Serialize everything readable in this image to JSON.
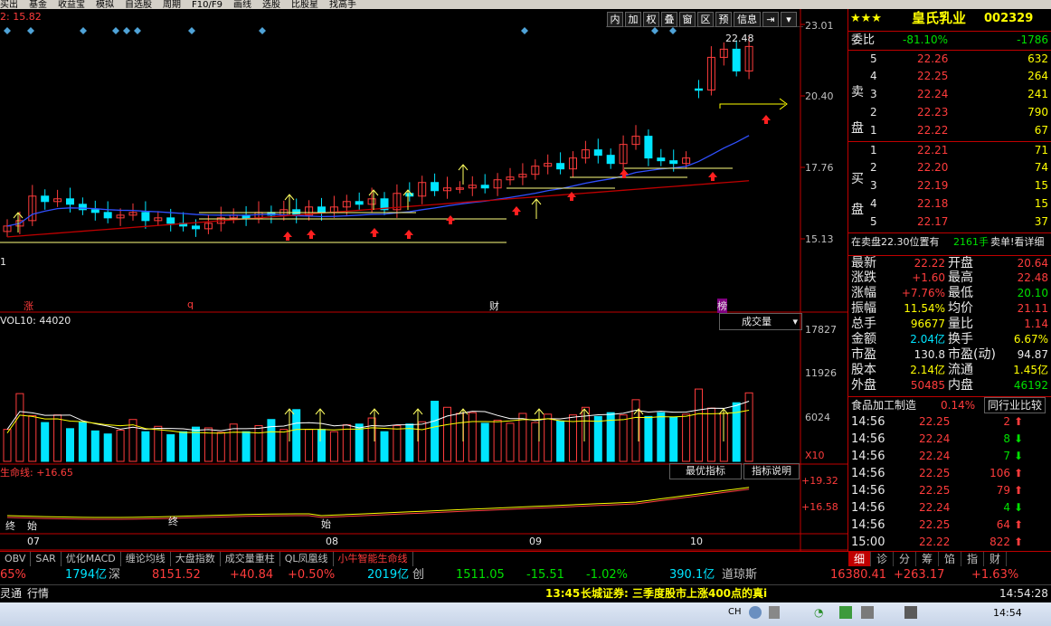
{
  "menu": [
    "买出",
    "基金",
    "收益宝",
    "模拟",
    "自选股",
    "周期",
    "F10/F9",
    "画线",
    "选股",
    "比股星",
    "找高手"
  ],
  "toolbar": [
    "内",
    "加",
    "权",
    "叠",
    "窗",
    "区",
    "预",
    "信息",
    "⇥",
    "▾"
  ],
  "stock": {
    "name": "皇氏乳业",
    "code": "002329",
    "stars": "★★★"
  },
  "price_axis": [
    "23.01",
    "20.40",
    "17.76",
    "15.13"
  ],
  "top_left_label": "2: 15.82",
  "max_label": "22.48",
  "first_price_label": "1",
  "event_markers": [
    {
      "label": "涨",
      "color": "#ff3c3c"
    },
    {
      "label": "q",
      "color": "#ff3c3c"
    },
    {
      "label": "财",
      "color": "#ffffff"
    },
    {
      "label": "榜",
      "color": "#ffffff"
    }
  ],
  "volume": {
    "title": "VOL10: 44020",
    "dropdown": "成交量",
    "axis": [
      "17827",
      "11926",
      "6024",
      "X10"
    ],
    "buttons": [
      "最优指标",
      "指标说明"
    ]
  },
  "lifeline": {
    "title": "生命线: +16.65",
    "axis": [
      "+19.32",
      "+16.58"
    ],
    "markers": [
      "终",
      "始",
      "终",
      "始"
    ]
  },
  "months": [
    "07",
    "08",
    "09",
    "10"
  ],
  "chart_data": {
    "type": "candlestick",
    "title": "皇氏乳业 002329",
    "x": [
      "07",
      "08",
      "09",
      "10"
    ],
    "ylim": [
      13.5,
      23.5
    ],
    "close_series": [
      15.6,
      15.8,
      16.7,
      16.5,
      16.6,
      16.4,
      16.2,
      16.1,
      15.9,
      16.0,
      16.1,
      15.8,
      15.9,
      15.7,
      15.6,
      15.5,
      15.7,
      15.9,
      16.0,
      15.9,
      16.1,
      16.0,
      16.2,
      16.0,
      16.3,
      16.1,
      16.3,
      16.5,
      16.4,
      16.6,
      16.2,
      16.8,
      16.7,
      17.2,
      16.9,
      17.0,
      17.0,
      17.1,
      17.0,
      17.3,
      17.4,
      17.5,
      17.8,
      17.9,
      17.7,
      18.1,
      18.4,
      18.2,
      17.9,
      18.6,
      18.9,
      18.1,
      18.0,
      17.9,
      18.1,
      20.6,
      21.8,
      22.1,
      21.3,
      22.2
    ],
    "vol_series": [
      4.2,
      8.9,
      6.0,
      5.1,
      6.1,
      4.3,
      5.2,
      4.0,
      3.6,
      4.1,
      5.5,
      3.9,
      4.6,
      3.5,
      3.9,
      4.5,
      4.4,
      3.8,
      4.9,
      3.9,
      4.7,
      5.5,
      4.2,
      6.8,
      4.2,
      4.2,
      3.9,
      4.8,
      4.9,
      5.7,
      3.9,
      4.7,
      4.9,
      5.2,
      7.9,
      7.1,
      6.3,
      6.4,
      5.0,
      5.4,
      5.0,
      6.3,
      5.1,
      6.2,
      5.3,
      6.1,
      7.1,
      5.9,
      6.4,
      6.1,
      8.1,
      5.9,
      6.4,
      5.8,
      6.2,
      9.5,
      7.0,
      6.3,
      7.7,
      9.0
    ],
    "volume_unit": "X10"
  },
  "panel": {
    "weibi": {
      "label": "委比",
      "pct": "-81.10%",
      "diff": "-1786"
    },
    "sell_label": "卖\n盘",
    "buy_label": "买\n盘",
    "sells": [
      {
        "n": "5",
        "p": "22.26",
        "v": "632"
      },
      {
        "n": "4",
        "p": "22.25",
        "v": "264"
      },
      {
        "n": "3",
        "p": "22.24",
        "v": "241"
      },
      {
        "n": "2",
        "p": "22.23",
        "v": "790"
      },
      {
        "n": "1",
        "p": "22.22",
        "v": "67"
      }
    ],
    "buys": [
      {
        "n": "1",
        "p": "22.21",
        "v": "71"
      },
      {
        "n": "2",
        "p": "22.20",
        "v": "74"
      },
      {
        "n": "3",
        "p": "22.19",
        "v": "15"
      },
      {
        "n": "4",
        "p": "22.18",
        "v": "15"
      },
      {
        "n": "5",
        "p": "22.17",
        "v": "37"
      }
    ],
    "sell_line": {
      "text": "在卖盘22.30位置有",
      "qty": "2161手",
      "tail": "卖单!看详细"
    },
    "stats": [
      {
        "l": "最新",
        "v": "22.22",
        "vc": "#ff3c3c",
        "l2": "开盘",
        "v2": "20.64",
        "v2c": "#ff3c3c"
      },
      {
        "l": "涨跌",
        "v": "+1.60",
        "vc": "#ff3c3c",
        "l2": "最高",
        "v2": "22.48",
        "v2c": "#ff3c3c"
      },
      {
        "l": "涨幅",
        "v": "+7.76%",
        "vc": "#ff3c3c",
        "l2": "最低",
        "v2": "20.10",
        "v2c": "#00e000"
      },
      {
        "l": "振幅",
        "v": "11.54%",
        "vc": "#ffff00",
        "l2": "均价",
        "v2": "21.11",
        "v2c": "#ff3c3c"
      },
      {
        "l": "总手",
        "v": "96677",
        "vc": "#ffff00",
        "l2": "量比",
        "v2": "1.14",
        "v2c": "#ff3c3c"
      },
      {
        "l": "金额",
        "v": "2.04亿",
        "vc": "#00e5ff",
        "l2": "换手",
        "v2": "6.67%",
        "v2c": "#ffff00"
      },
      {
        "l": "市盈",
        "v": "130.8",
        "vc": "#e8e8e8",
        "l2": "市盈(动)",
        "v2": "94.87",
        "v2c": "#e8e8e8"
      },
      {
        "l": "股本",
        "v": "2.14亿",
        "vc": "#ffff00",
        "l2": "流通",
        "v2": "1.45亿",
        "v2c": "#ffff00"
      },
      {
        "l": "外盘",
        "v": "50485",
        "vc": "#ff3c3c",
        "l2": "内盘",
        "v2": "46192",
        "v2c": "#00e000"
      }
    ],
    "industry": {
      "name": "食品加工制造",
      "pct": "0.14%",
      "btn": "同行业比较"
    },
    "ticks": [
      {
        "t": "14:56",
        "p": "22.25",
        "v": "2",
        "d": "up"
      },
      {
        "t": "14:56",
        "p": "22.24",
        "v": "8",
        "d": "down"
      },
      {
        "t": "14:56",
        "p": "22.24",
        "v": "7",
        "d": "down"
      },
      {
        "t": "14:56",
        "p": "22.25",
        "v": "106",
        "d": "up"
      },
      {
        "t": "14:56",
        "p": "22.25",
        "v": "79",
        "d": "up"
      },
      {
        "t": "14:56",
        "p": "22.24",
        "v": "4",
        "d": "down"
      },
      {
        "t": "14:56",
        "p": "22.25",
        "v": "64",
        "d": "up"
      },
      {
        "t": "15:00",
        "p": "22.22",
        "v": "822",
        "d": "up"
      }
    ],
    "bottom_tabs": [
      "细",
      "诊",
      "分",
      "筹",
      "馅",
      "指",
      "财"
    ]
  },
  "indicator_tabs": [
    "OBV",
    "SAR",
    "优化MACD",
    "缠论均线",
    "大盘指数",
    "成交量重柱",
    "QL凤凰线",
    "小牛智能生命线"
  ],
  "index_bar": [
    {
      "x": 0,
      "t": "65%",
      "c": "#ff3c3c"
    },
    {
      "x": 72,
      "t": "1794亿",
      "c": "#00e5ff"
    },
    {
      "x": 120,
      "t": "深",
      "c": "#c0c0c0"
    },
    {
      "x": 168,
      "t": "8151.52",
      "c": "#ff3c3c"
    },
    {
      "x": 254,
      "t": "+40.84",
      "c": "#ff3c3c"
    },
    {
      "x": 318,
      "t": "+0.50%",
      "c": "#ff3c3c"
    },
    {
      "x": 406,
      "t": "2019亿",
      "c": "#00e5ff"
    },
    {
      "x": 456,
      "t": "创",
      "c": "#c0c0c0"
    },
    {
      "x": 504,
      "t": "1511.05",
      "c": "#00e000"
    },
    {
      "x": 582,
      "t": "-15.51",
      "c": "#00e000"
    },
    {
      "x": 648,
      "t": "-1.02%",
      "c": "#00e000"
    },
    {
      "x": 740,
      "t": "390.1亿",
      "c": "#00e5ff"
    },
    {
      "x": 798,
      "t": "道琼斯",
      "c": "#c0c0c0"
    },
    {
      "x": 918,
      "t": "16380.41",
      "c": "#ff3c3c"
    },
    {
      "x": 988,
      "t": "+263.17",
      "c": "#ff3c3c"
    },
    {
      "x": 1074,
      "t": "+1.63%",
      "c": "#ff3c3c"
    }
  ],
  "status": {
    "left1": "灵通",
    "left2": "行情",
    "news_time": "13:45",
    "news": "长城证券: 三季度股市上涨400点的真i",
    "time": "14:54:28"
  },
  "taskbar": {
    "lang": "CH",
    "clock": "14:54"
  }
}
